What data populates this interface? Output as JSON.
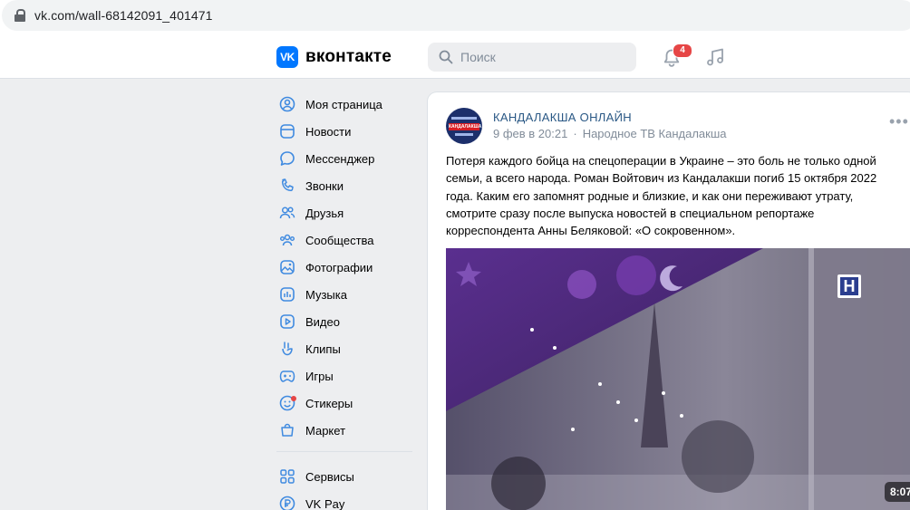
{
  "browser": {
    "url": "vk.com/wall-68142091_401471"
  },
  "header": {
    "logo_letters": "VK",
    "logo_text": "вконтакте",
    "search_placeholder": "Поиск",
    "notifications_count": "4"
  },
  "sidebar": {
    "items": [
      {
        "label": "Моя страница",
        "icon": "user-circle-icon"
      },
      {
        "label": "Новости",
        "icon": "newsfeed-icon"
      },
      {
        "label": "Мессенджер",
        "icon": "message-icon"
      },
      {
        "label": "Звонки",
        "icon": "phone-icon"
      },
      {
        "label": "Друзья",
        "icon": "friends-icon"
      },
      {
        "label": "Сообщества",
        "icon": "communities-icon"
      },
      {
        "label": "Фотографии",
        "icon": "photo-icon"
      },
      {
        "label": "Музыка",
        "icon": "music-icon"
      },
      {
        "label": "Видео",
        "icon": "video-icon"
      },
      {
        "label": "Клипы",
        "icon": "clips-icon"
      },
      {
        "label": "Игры",
        "icon": "gamepad-icon"
      },
      {
        "label": "Стикеры",
        "icon": "smile-icon"
      },
      {
        "label": "Маркет",
        "icon": "market-bag-icon"
      }
    ],
    "extra_items": [
      {
        "label": "Сервисы",
        "icon": "services-grid-icon"
      },
      {
        "label": "VK Pay",
        "icon": "vkpay-icon"
      }
    ]
  },
  "post": {
    "group_name": "КАНДАЛАКША ОНЛАЙН",
    "avatar_text": "КАНДАЛАКША",
    "date": "9 фев в 20:21",
    "source": "Народное ТВ Кандалакша",
    "text": "Потеря каждого бойца на спецоперации в Украине – это боль не только одной семьи, а всего народа. Роман Войтович из Кандалакши погиб 15 октября 2022 года. Каким его запомнят родные и близкие, и как они переживают утрату, смотрите сразу после выпуска новостей в специальном репортаже корреспондента Анны Беляковой: «О сокровенном».",
    "video_duration": "8:07",
    "video_logo": "Н"
  },
  "colors": {
    "accent": "#0077ff",
    "link": "#2a5885",
    "badge": "#e64646",
    "icon": "#3f8ae0"
  }
}
